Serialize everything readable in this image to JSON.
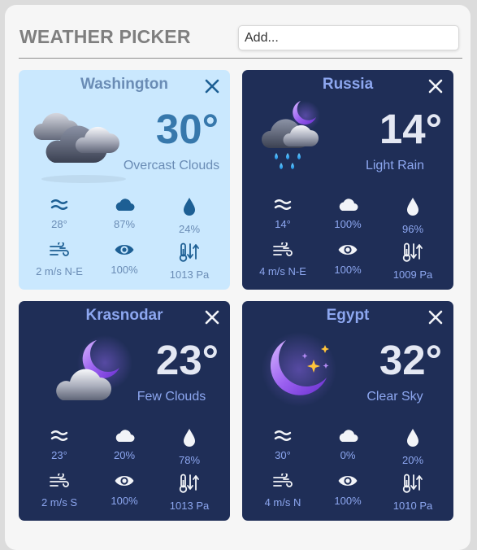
{
  "header": {
    "title": "WEATHER PICKER",
    "add_placeholder": "Add..."
  },
  "cards": [
    {
      "city": "Washington",
      "theme": "light",
      "icon": "overcast-clouds-icon",
      "temp": "30°",
      "description": "Overcast Clouds",
      "stats": {
        "feels_like": "28°",
        "cloudiness": "87%",
        "humidity": "24%",
        "wind": "2 m/s N-E",
        "visibility": "100%",
        "pressure": "1013 Pa"
      }
    },
    {
      "city": "Russia",
      "theme": "dark",
      "icon": "night-rain-icon",
      "temp": "14°",
      "description": "Light Rain",
      "stats": {
        "feels_like": "14°",
        "cloudiness": "100%",
        "humidity": "96%",
        "wind": "4 m/s N-E",
        "visibility": "100%",
        "pressure": "1009 Pa"
      }
    },
    {
      "city": "Krasnodar",
      "theme": "dark",
      "icon": "night-few-clouds-icon",
      "temp": "23°",
      "description": "Few Clouds",
      "stats": {
        "feels_like": "23°",
        "cloudiness": "20%",
        "humidity": "78%",
        "wind": "2 m/s S",
        "visibility": "100%",
        "pressure": "1013 Pa"
      }
    },
    {
      "city": "Egypt",
      "theme": "dark",
      "icon": "clear-night-moon-icon",
      "temp": "32°",
      "description": "Clear Sky",
      "stats": {
        "feels_like": "30°",
        "cloudiness": "0%",
        "humidity": "20%",
        "wind": "4 m/s N",
        "visibility": "100%",
        "pressure": "1010 Pa"
      }
    }
  ],
  "colors": {
    "dark_card_bg": "#1f2e57",
    "light_card_bg": "#cae8fe",
    "dark_accent": "#8da7f0",
    "light_accent": "#6a8cb5",
    "light_icon": "#1d5f94",
    "dark_icon": "#f2f4f8"
  }
}
